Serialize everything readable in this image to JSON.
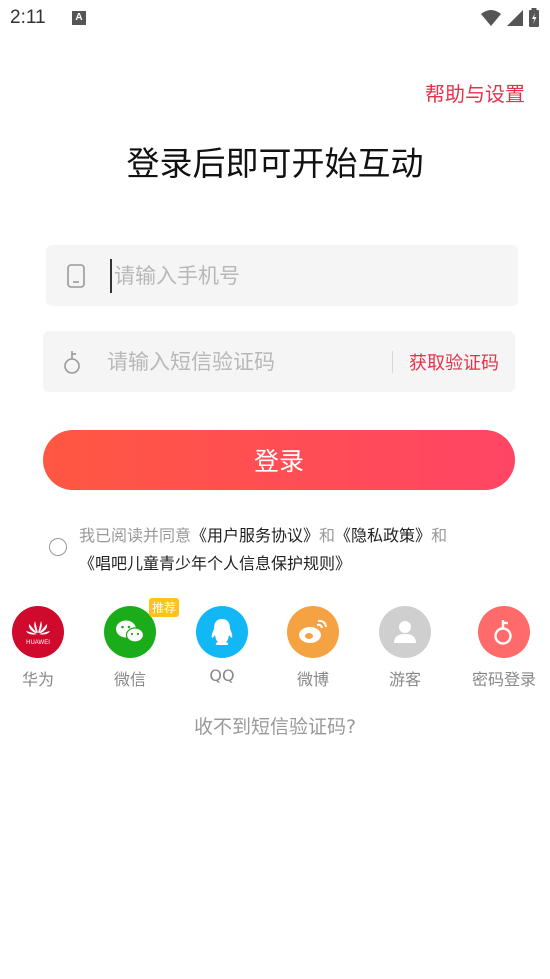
{
  "status": {
    "time": "2:11",
    "notification_letter": "A"
  },
  "header": {
    "help_label": "帮助与设置"
  },
  "title": "登录后即可开始互动",
  "form": {
    "phone_placeholder": "请输入手机号",
    "code_placeholder": "请输入短信验证码",
    "get_code_label": "获取验证码",
    "login_label": "登录"
  },
  "agreement": {
    "prefix": "我已阅读并同意",
    "user_agreement": "《用户服务协议》",
    "and1": "和",
    "privacy": "《隐私政策》",
    "and2": "和",
    "child_policy": "《唱吧儿童青少年个人信息保护规则》"
  },
  "third_party": {
    "huawei": {
      "label": "华为",
      "logo_text": "HUAWEI",
      "color": "#cf0a2c"
    },
    "wechat": {
      "label": "微信",
      "badge": "推荐",
      "color": "#1aad19"
    },
    "qq": {
      "label": "QQ",
      "color": "#12b7f5"
    },
    "weibo": {
      "label": "微博",
      "color": "#f5a243"
    },
    "guest": {
      "label": "游客",
      "color": "#cfcfcf"
    },
    "password": {
      "label": "密码登录",
      "color": "#ff6a6a"
    }
  },
  "footer": {
    "no_code_label": "收不到短信验证码?"
  },
  "colors": {
    "accent": "#e5334b",
    "button_start": "#ff5742",
    "button_end": "#ff4565"
  }
}
